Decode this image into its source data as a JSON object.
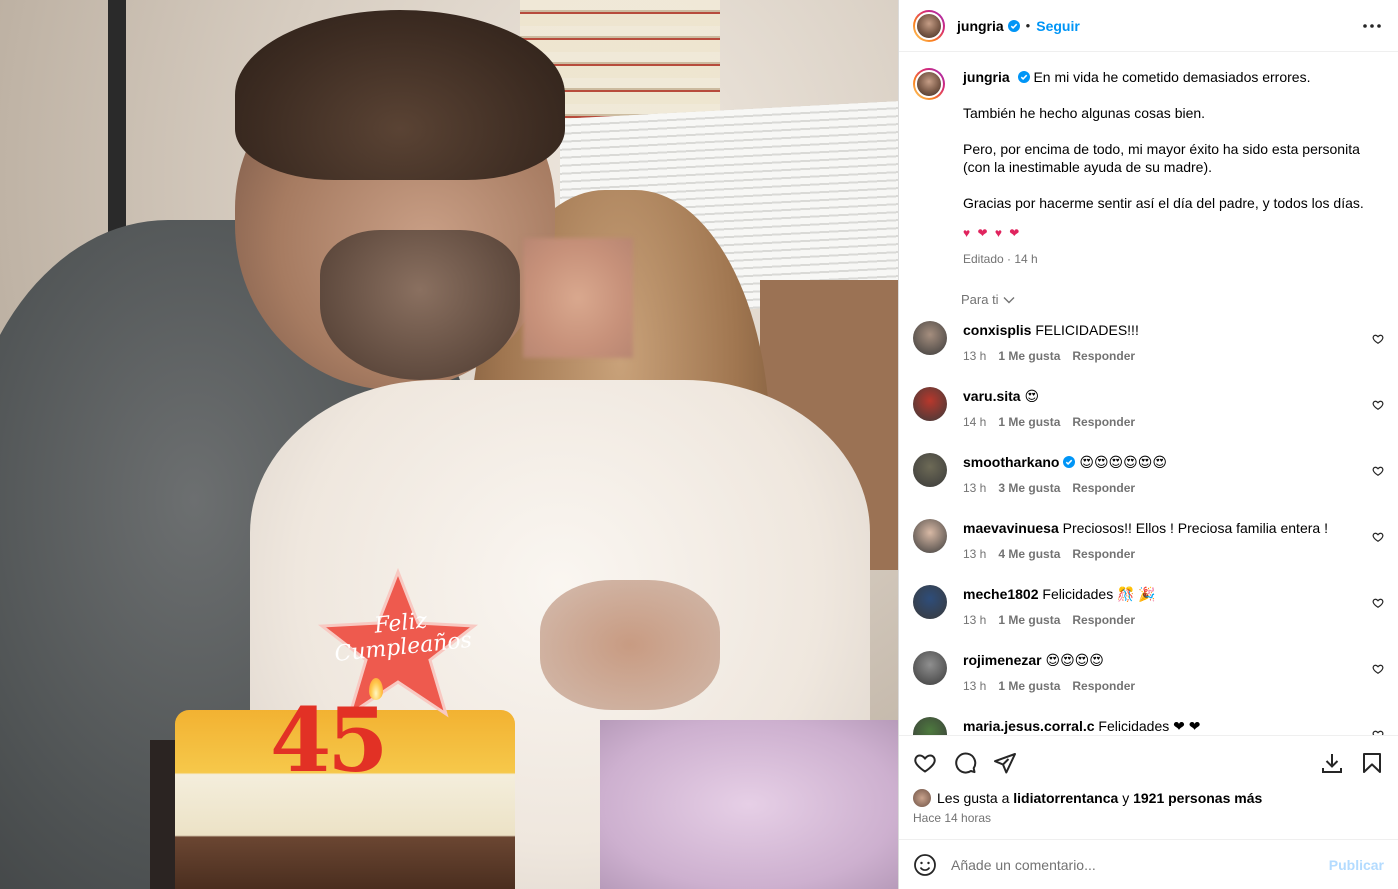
{
  "post": {
    "username": "jungria",
    "follow_label": "Seguir",
    "separator": "•",
    "caption": {
      "line1": "En mi vida he cometido demasiados errores.",
      "line2": "También he hecho algunas cosas bien.",
      "line3": "Pero, por encima de todo, mi mayor éxito ha sido esta personita (con la inestimable ayuda de su madre).",
      "line4": "Gracias por hacerme sentir así el día del padre, y todos los días.",
      "emojis": "♥ ❤ ♥ ❤",
      "meta": "Editado · 14 h"
    },
    "photo": {
      "sign_line1": "Feliz",
      "sign_line2": "Cumpleaños",
      "candles": "45"
    }
  },
  "filter_label": "Para ti",
  "comments": [
    {
      "user": "conxisplis",
      "text": "FELICIDADES!!!",
      "time": "13 h",
      "likes": "1 Me gusta",
      "reply": "Responder",
      "verified": false
    },
    {
      "user": "varu.sita",
      "text": "😍",
      "time": "14 h",
      "likes": "1 Me gusta",
      "reply": "Responder",
      "verified": false
    },
    {
      "user": "smootharkano",
      "text": "😍😍😍😍😍😍",
      "time": "13 h",
      "likes": "3 Me gusta",
      "reply": "Responder",
      "verified": true
    },
    {
      "user": "maevavinuesa",
      "text": "Preciosos!! Ellos ! Preciosa familia entera !",
      "time": "13 h",
      "likes": "4 Me gusta",
      "reply": "Responder",
      "verified": false
    },
    {
      "user": "meche1802",
      "text": "Felicidades 🎊 🎉",
      "time": "13 h",
      "likes": "1 Me gusta",
      "reply": "Responder",
      "verified": false
    },
    {
      "user": "rojimenezar",
      "text": "😍😍😍😍",
      "time": "13 h",
      "likes": "1 Me gusta",
      "reply": "Responder",
      "verified": false
    },
    {
      "user": "maria.jesus.corral.c",
      "text": "Felicidades ❤ ❤",
      "time": "",
      "likes": "",
      "reply": "",
      "verified": false
    }
  ],
  "likes": {
    "prefix": "Les gusta a",
    "user": "lidiatorrentanca",
    "middle": "y",
    "count": "1921 personas más"
  },
  "posted_ago": "Hace 14 horas",
  "add_comment": {
    "placeholder": "Añade un comentario...",
    "publish_label": "Publicar"
  },
  "colors": {
    "accent": "#0095f6",
    "publish_disabled": "#b3dbff",
    "muted": "#737373"
  },
  "icons": [
    "more-icon",
    "verified-icon",
    "chevron-down-icon",
    "heart-icon",
    "comment-icon",
    "share-icon",
    "save-icon",
    "emoji-icon"
  ]
}
